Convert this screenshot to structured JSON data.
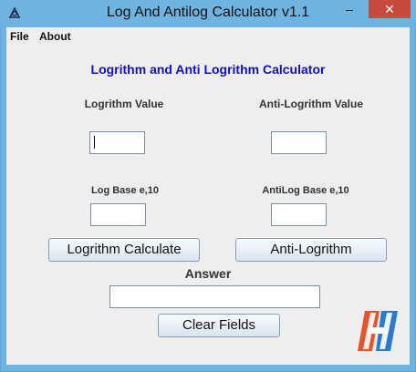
{
  "window": {
    "title": "Log And Antilog Calculator v1.1",
    "buttons": {
      "minimize": "–",
      "maximize": "□",
      "close": "✕"
    },
    "icon": "calculator-app-icon"
  },
  "menu": {
    "items": [
      "File",
      "About"
    ]
  },
  "heading": "Logrithm and Anti Logrithm Calculator",
  "labels": {
    "log_value": "Logrithm Value",
    "antilog_value": "Anti-Logrithm Value",
    "log_base": "Log Base e,10",
    "antilog_base": "AntiLog Base e,10",
    "answer": "Answer"
  },
  "fields": {
    "log_value": "",
    "antilog_value": "",
    "log_base": "",
    "antilog_base": "",
    "answer": ""
  },
  "buttons": {
    "log_calculate": "Logrithm Calculate",
    "antilog": "Anti-Logrithm",
    "clear": "Clear Fields"
  },
  "colors": {
    "title_bar": "#6fb3e0",
    "close_button": "#c84a3e",
    "heading_text": "#1010cc",
    "logo_orange": "#e8542a",
    "logo_blue": "#2a7ad0"
  },
  "logo": "red-blue-h-logo"
}
